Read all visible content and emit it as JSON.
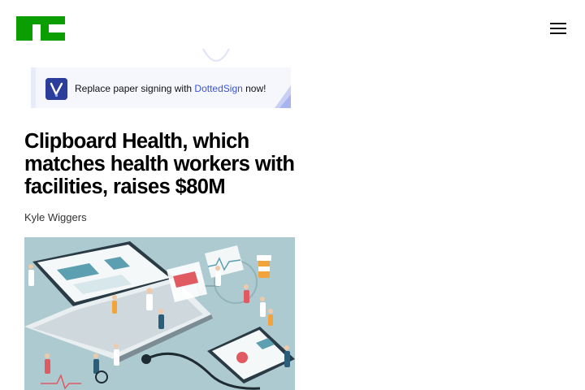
{
  "header": {
    "logo": {
      "label": "TC",
      "color": "#0a9e01"
    },
    "menu_icon": "hamburger-menu-icon"
  },
  "ad": {
    "text_prefix": "Replace paper signing with ",
    "brand": "DottedSign",
    "text_suffix": " now!",
    "brand_color": "#3b54d6",
    "icon": "dottedsign-logo-icon"
  },
  "article": {
    "headline": "Clipboard Health, which matches health workers with facilities, raises $80M",
    "author": "Kyle Wiggers",
    "image": "healthcare-illustration"
  }
}
